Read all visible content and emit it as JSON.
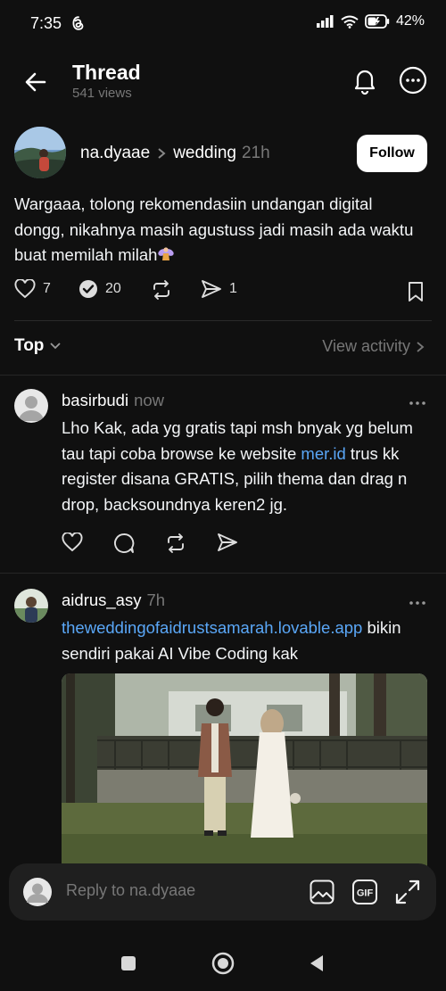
{
  "status_bar": {
    "time": "7:35",
    "battery": "42%"
  },
  "header": {
    "title": "Thread",
    "views": "541 views"
  },
  "post": {
    "username": "na.dyaae",
    "topic": "wedding",
    "time": "21h",
    "follow_label": "Follow",
    "text": "Wargaaa, tolong rekomendasiin undangan digital dongg, nikahnya masih agustuss jadi masih ada waktu buat memilah milah",
    "likes": "7",
    "replies": "20",
    "shares": "1"
  },
  "sort": {
    "label": "Top",
    "view_activity": "View activity"
  },
  "replies": [
    {
      "username": "basirbudi",
      "time": "now",
      "text_before": "Lho Kak, ada yg gratis tapi msh bnyak yg belum tau tapi coba browse ke website ",
      "link": "mer.id",
      "text_after": " trus kk register disana GRATIS, pilih thema dan drag n drop, backsoundnya keren2 jg."
    },
    {
      "username": "aidrus_asy",
      "time": "7h",
      "link": "theweddingofaidrustsamarah.lovable.app",
      "text_after": " bikin sendiri pakai AI Vibe Coding kak"
    }
  ],
  "composer": {
    "placeholder": "Reply to na.dyaae",
    "gif_label": "GIF"
  },
  "icons": {
    "back": "arrow-left-icon",
    "bell": "bell-icon",
    "more": "more-circle-icon",
    "like": "heart-icon",
    "reply": "comment-check-icon",
    "repost": "repost-icon",
    "share": "send-icon",
    "bookmark": "bookmark-icon"
  },
  "colors": {
    "background": "#101010",
    "link": "#5aa7f7",
    "muted": "#777777"
  }
}
